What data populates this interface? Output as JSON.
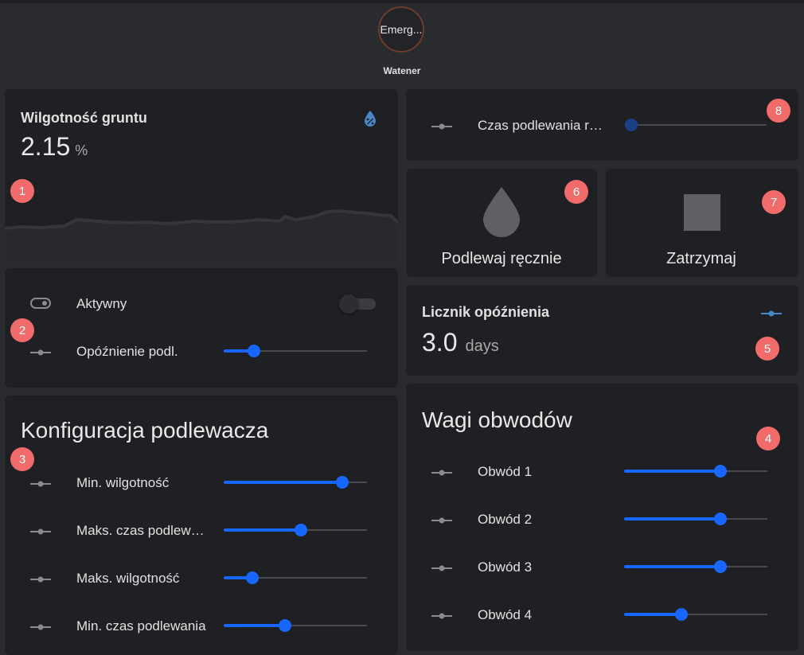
{
  "header": {
    "badge_text": "Emerg...",
    "badge_label": "Watener"
  },
  "soil_card": {
    "title": "Wilgotność gruntu",
    "value": "2.15",
    "unit": "%",
    "icon": "water-percent-icon"
  },
  "controls_card": {
    "active_label": "Aktywny",
    "active_on": false,
    "delay_label": "Opóźnienie podl.",
    "delay_value": 0.21
  },
  "config_card": {
    "title": "Konfiguracja podlewacza",
    "rows": [
      {
        "label": "Min. wilgotność",
        "value": 0.83
      },
      {
        "label": "Maks. czas podlewania",
        "value": 0.54
      },
      {
        "label": "Maks. wilgotność",
        "value": 0.2
      },
      {
        "label": "Min. czas podlewania",
        "value": 0.43
      }
    ]
  },
  "time_card": {
    "label": "Czas podlewania ręcznego",
    "value": 0.0
  },
  "actions": {
    "water_label": "Podlewaj ręcznie",
    "stop_label": "Zatrzymaj"
  },
  "delay_counter": {
    "title": "Licznik opóźnienia",
    "value": "3.0",
    "unit": "days"
  },
  "circuits_card": {
    "title": "Wagi obwodów",
    "rows": [
      {
        "label": "Obwód 1",
        "value": 0.67
      },
      {
        "label": "Obwód 2",
        "value": 0.67
      },
      {
        "label": "Obwód 3",
        "value": 0.67
      },
      {
        "label": "Obwód 4",
        "value": 0.4
      }
    ]
  },
  "markers": [
    "1",
    "2",
    "3",
    "4",
    "5",
    "6",
    "7",
    "8"
  ],
  "colors": {
    "accent": "#1766ff",
    "marker": "#f26b6b",
    "card": "#1f2023",
    "background": "#2a2b2e"
  }
}
